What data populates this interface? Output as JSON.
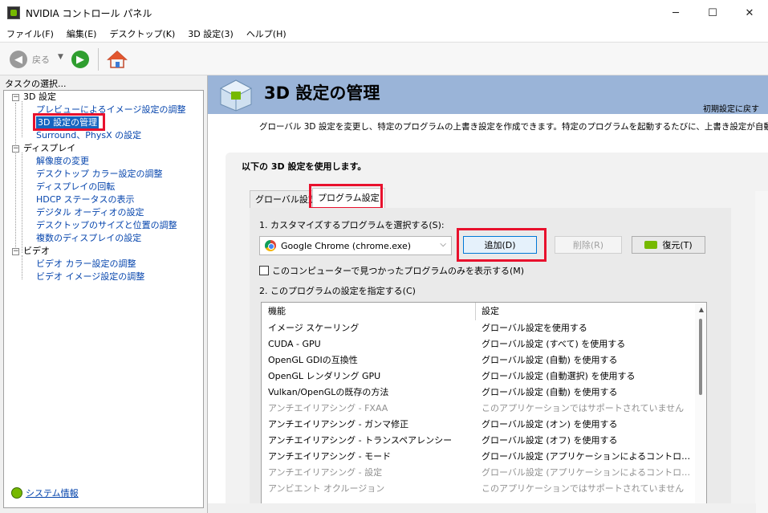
{
  "window": {
    "title": "NVIDIA コントロール パネル",
    "minimize": "─",
    "maximize": "☐",
    "close": "✕"
  },
  "menu": [
    "ファイル(F)",
    "編集(E)",
    "デスクトップ(K)",
    "3D 設定(3)",
    "ヘルプ(H)"
  ],
  "toolbar": {
    "back_label": "戻る",
    "back_dropdown": "▼",
    "back_glyph": "◀",
    "forward_glyph": "▶"
  },
  "left": {
    "header": "タスクの選択...",
    "tree": [
      {
        "label": "3D 設定",
        "type": "category"
      },
      {
        "label": "プレビューによるイメージ設定の調整",
        "type": "link"
      },
      {
        "label": "3D 設定の管理",
        "type": "link",
        "selected": true
      },
      {
        "label": "Surround、PhysX の設定",
        "type": "link"
      },
      {
        "label": "ディスプレイ",
        "type": "category"
      },
      {
        "label": "解像度の変更",
        "type": "link"
      },
      {
        "label": "デスクトップ カラー設定の調整",
        "type": "link"
      },
      {
        "label": "ディスプレイの回転",
        "type": "link"
      },
      {
        "label": "HDCP ステータスの表示",
        "type": "link"
      },
      {
        "label": "デジタル オーディオの設定",
        "type": "link"
      },
      {
        "label": "デスクトップのサイズと位置の調整",
        "type": "link"
      },
      {
        "label": "複数のディスプレイの設定",
        "type": "link"
      },
      {
        "label": "ビデオ",
        "type": "category"
      },
      {
        "label": "ビデオ カラー設定の調整",
        "type": "link"
      },
      {
        "label": "ビデオ イメージ設定の調整",
        "type": "link"
      }
    ],
    "expander_glyph": "−",
    "system_info": "システム情報"
  },
  "main": {
    "title": "3D 設定の管理",
    "restore_defaults": "初期設定に戻す",
    "description": "グローバル 3D 設定を変更し、特定のプログラムの上書き設定を作成できます。特定のプログラムを起動するたびに、上書き設定が自動",
    "box_heading": "以下の 3D 設定を使用します。",
    "tabs": [
      "グローバル設定",
      "プログラム設定"
    ],
    "step1": "1. カスタマイズするプログラムを選択する(S):",
    "program_selected": "Google Chrome (chrome.exe)",
    "combo_arrow": "⌵",
    "add_button": "追加(D)",
    "remove_button": "削除(R)",
    "restore_button": "復元(T)",
    "only_found_checkbox": "このコンピューターで見つかったプログラムのみを表示する(M)",
    "step2": "2. このプログラムの設定を指定する(C)",
    "grid": {
      "headers": [
        "機能",
        "設定"
      ],
      "rows": [
        {
          "feature": "イメージ スケーリング",
          "setting": "グローバル設定を使用する",
          "dim": false
        },
        {
          "feature": "CUDA - GPU",
          "setting": "グローバル設定 (すべて) を使用する",
          "dim": false
        },
        {
          "feature": "OpenGL GDIの互換性",
          "setting": "グローバル設定 (自動) を使用する",
          "dim": false
        },
        {
          "feature": "OpenGL レンダリング GPU",
          "setting": "グローバル設定 (自動選択) を使用する",
          "dim": false
        },
        {
          "feature": "Vulkan/OpenGLの既存の方法",
          "setting": "グローバル設定 (自動) を使用する",
          "dim": false
        },
        {
          "feature": "アンチエイリアシング - FXAA",
          "setting": "このアプリケーションではサポートされていません",
          "dim": true
        },
        {
          "feature": "アンチエイリアシング - ガンマ修正",
          "setting": "グローバル設定 (オン) を使用する",
          "dim": false
        },
        {
          "feature": "アンチエイリアシング - トランスペアレンシー",
          "setting": "グローバル設定 (オフ) を使用する",
          "dim": false
        },
        {
          "feature": "アンチエイリアシング - モード",
          "setting": "グローバル設定 (アプリケーションによるコントロール) を...",
          "dim": false
        },
        {
          "feature": "アンチエイリアシング - 設定",
          "setting": "グローバル設定 (アプリケーションによるコントロール) を...",
          "dim": true
        },
        {
          "feature": "アンビエント オクルージョン",
          "setting": "このアプリケーションではサポートされていません",
          "dim": true
        }
      ]
    },
    "scroll_up_glyph": "▲"
  },
  "colors": {
    "banner": "#9ab4d8",
    "highlight": "#e8112d",
    "selection": "#1565c0",
    "nvidia_green": "#76b900"
  }
}
